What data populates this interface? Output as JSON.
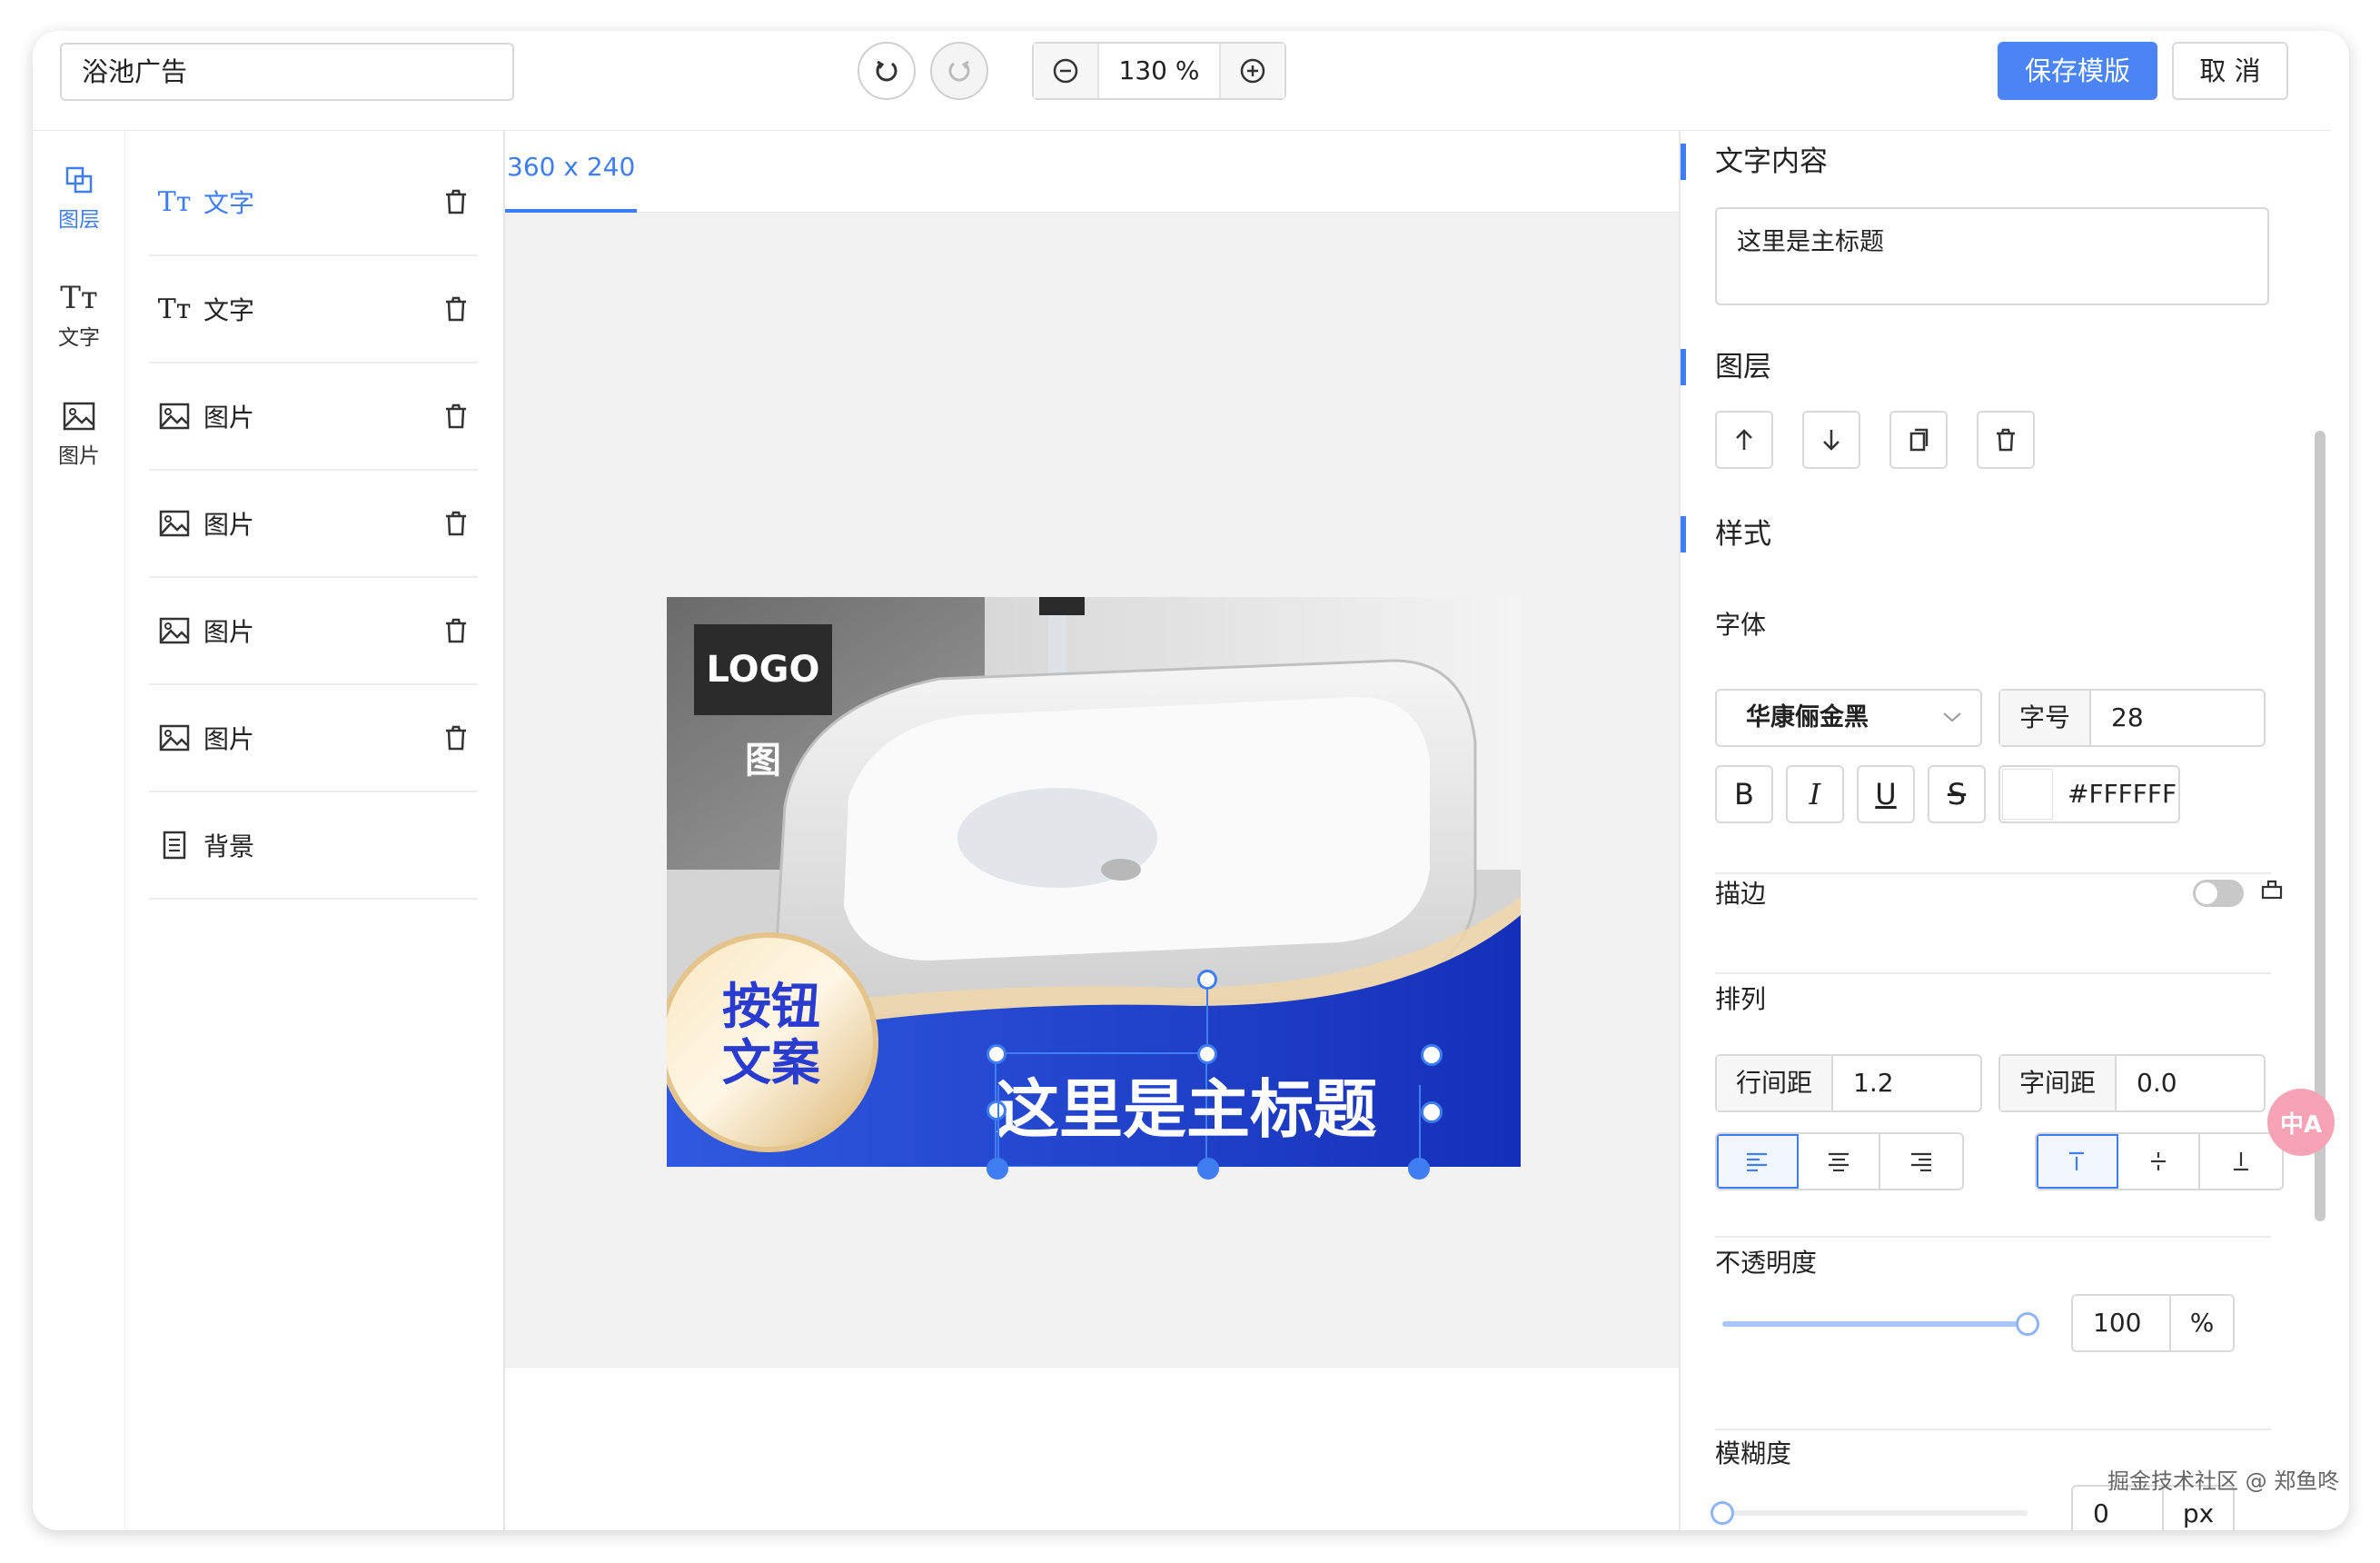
{
  "topbar": {
    "name_value": "浴池广告",
    "zoom_value": "130 %",
    "save_label": "保存模版",
    "cancel_label": "取 消"
  },
  "rail": {
    "items": [
      {
        "label": "图层",
        "icon": "layers-icon"
      },
      {
        "label": "文字",
        "icon": "text-icon"
      },
      {
        "label": "图片",
        "icon": "image-icon"
      }
    ]
  },
  "layers": {
    "items": [
      {
        "label": "文字",
        "icon": "text-icon",
        "active": true
      },
      {
        "label": "文字",
        "icon": "text-icon"
      },
      {
        "label": "图片",
        "icon": "image-icon"
      },
      {
        "label": "图片",
        "icon": "image-icon"
      },
      {
        "label": "图片",
        "icon": "image-icon"
      },
      {
        "label": "图片",
        "icon": "image-icon"
      },
      {
        "label": "背景",
        "icon": "background-icon"
      }
    ]
  },
  "canvas": {
    "tab_label": "360 x 240",
    "banner": {
      "logo_text": "LOGO图",
      "button_line1": "按钮",
      "button_line2": "文案",
      "title": "这里是主标题"
    }
  },
  "props": {
    "text_section": "文字内容",
    "text_value": "这里是主标题",
    "layer_section": "图层",
    "style_section": "样式",
    "font_label": "字体",
    "font_value": "华康俪金黑",
    "size_label": "字号",
    "size_value": "28",
    "color_value": "#FFFFFF",
    "stroke_label": "描边",
    "arrange_label": "排列",
    "line_height_label": "行间距",
    "line_height_value": "1.2",
    "letter_spacing_label": "字间距",
    "letter_spacing_value": "0.0",
    "opacity_label": "不透明度",
    "opacity_value": "100",
    "opacity_unit": "%",
    "opacity_fraction": 1.0,
    "blur_label": "模糊度",
    "blur_value": "0",
    "blur_unit": "px",
    "blur_fraction": 0.0
  },
  "watermark": "掘金技术社区 @ 郑鱼咚",
  "colors": {
    "accent": "#4a84f5",
    "banner_blue": "#1c44c8",
    "button_text": "#2a3ccf"
  }
}
